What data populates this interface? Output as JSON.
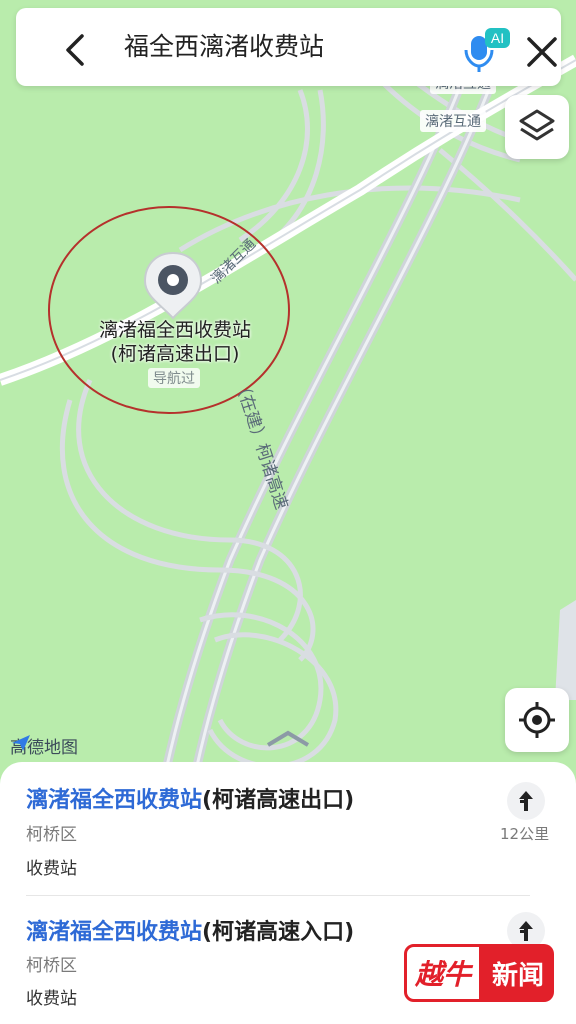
{
  "search": {
    "query": "福全西漓渚收费站"
  },
  "map": {
    "road_labels": [
      "漓渚互通",
      "漓渚互通",
      "（在建）柯诸高速"
    ],
    "poi": {
      "title_line1": "漓渚福全西收费站",
      "title_line2": "(柯诸高速出口)",
      "nav_tag": "导航过"
    },
    "logo_text": "高德地图"
  },
  "results": [
    {
      "name_highlight": "漓渚福全西收费站",
      "name_suffix": "(柯诸高速出口)",
      "district": "柯桥区",
      "type": "收费站",
      "distance": "12公里"
    },
    {
      "name_highlight": "漓渚福全西收费站",
      "name_suffix": "(柯诸高速入口)",
      "district": "柯桥区",
      "type": "收费站"
    }
  ],
  "watermark": {
    "left": "越牛",
    "right": "新闻"
  },
  "colors": {
    "accent": "#2e6ad6",
    "map_bg": "#b9ecac",
    "annotation_circle": "#b5312c",
    "watermark_red": "#e2202a"
  }
}
